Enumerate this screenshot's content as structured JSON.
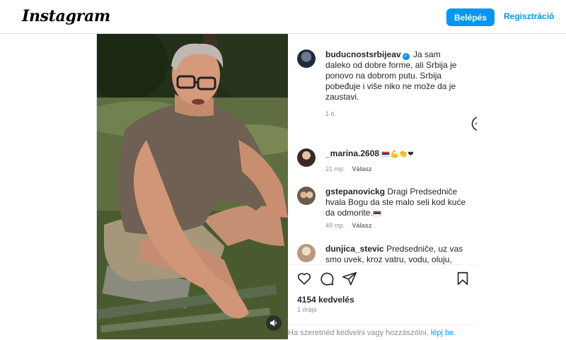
{
  "header": {
    "logo": "Instagram",
    "login_label": "Belépés",
    "register_label": "Regisztráció"
  },
  "post": {
    "owner": "buducnostsrbijeav",
    "caption": "Ja sam daleko od dobre forme, ali Srbija je ponovo na dobrom putu. Srbija pobeđuje i više niko ne može da je zaustavi.",
    "caption_time": "1 ó.",
    "comments": [
      {
        "username": "_marina.2608",
        "text": "",
        "emoji": "💪👏❤",
        "time": "21 mp.",
        "reply": "Válasz"
      },
      {
        "username": "gstepanovickg",
        "text": "Dragi Predsedniče hvala Bogu da ste malo seli kod kuće da odmorite.",
        "time": "49 mp.",
        "reply": "Válasz"
      },
      {
        "username": "dunjica_stevic",
        "text": "Predsedniče, uz vas smo uvek, kroz vatru, vodu, oluju, uvek"
      }
    ],
    "likes": "4154 kedvelés",
    "post_time": "1 órája",
    "login_prompt_text": "Ha szeretnéd kedvelni vagy hozzászólni,",
    "login_prompt_link": "lépj be",
    "login_prompt_end": "."
  },
  "icons": {
    "like": "heart-icon",
    "comment": "comment-icon",
    "share": "share-icon",
    "save": "bookmark-icon",
    "add": "plus-circle-icon",
    "mute": "speaker-icon",
    "verified": "verified-badge-icon"
  },
  "colors": {
    "accent": "#0095f6",
    "text": "#262626",
    "muted": "#8e8e8e"
  }
}
